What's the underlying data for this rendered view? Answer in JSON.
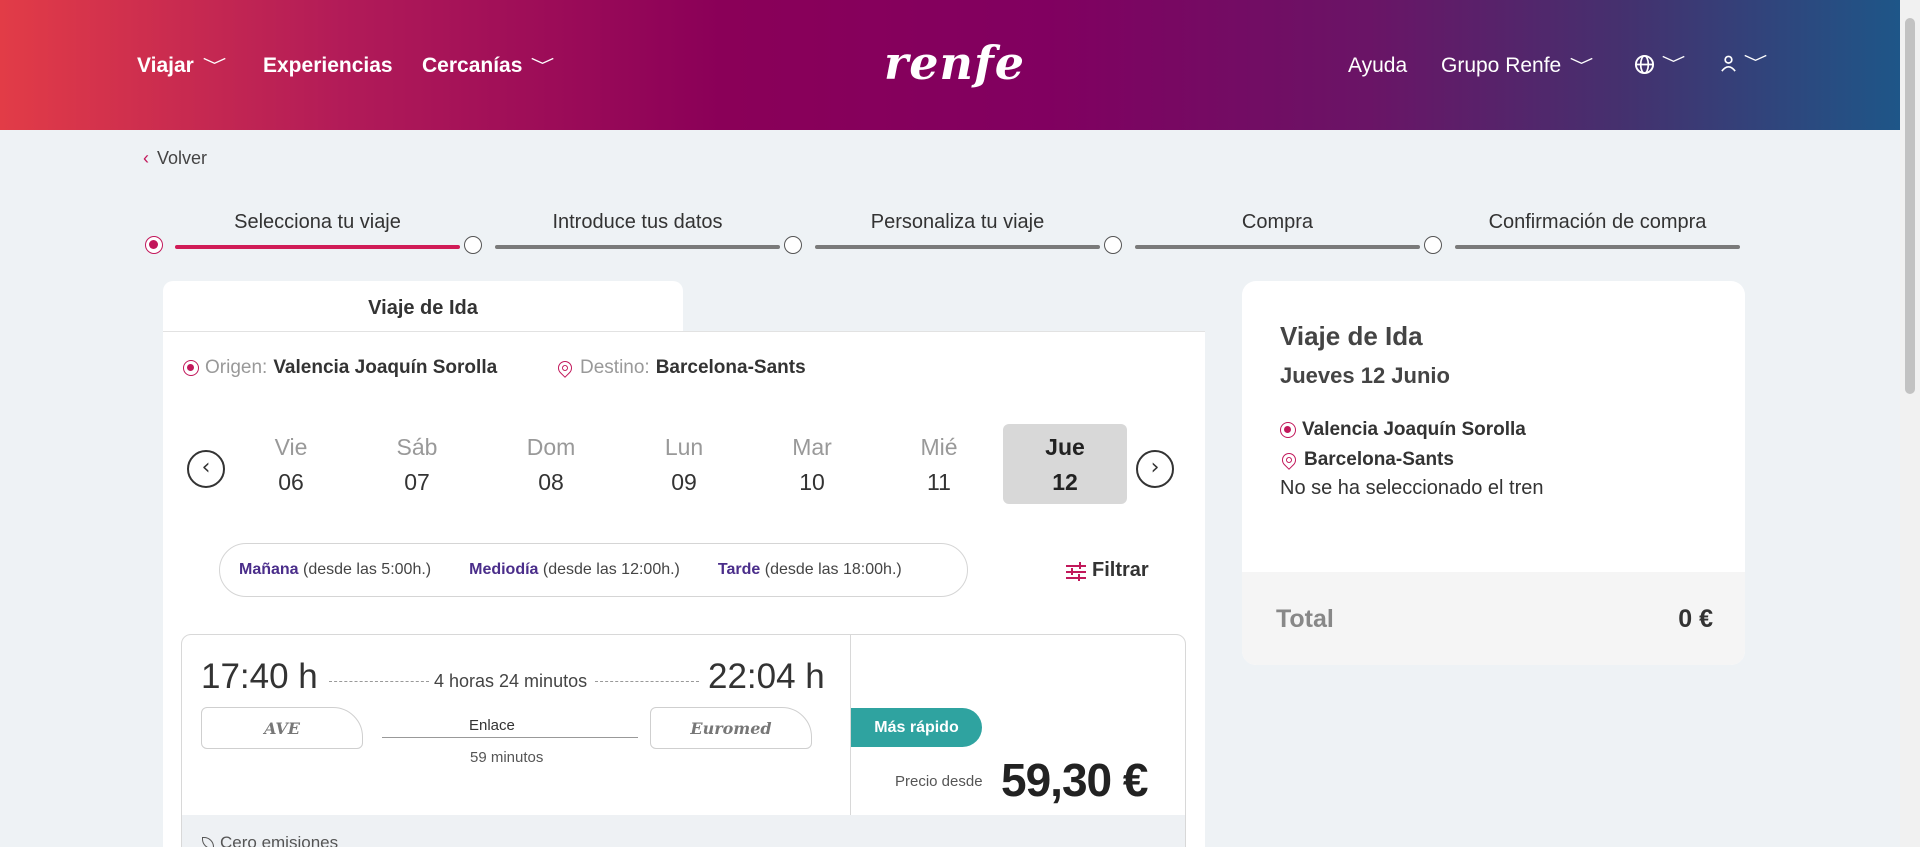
{
  "header": {
    "nav": [
      {
        "label": "Viajar",
        "has_dropdown": true
      },
      {
        "label": "Experiencias",
        "has_dropdown": false
      },
      {
        "label": "Cercanías",
        "has_dropdown": true
      }
    ],
    "logo_text": "renfe",
    "right": [
      {
        "label": "Ayuda",
        "has_dropdown": false
      },
      {
        "label": "Grupo Renfe",
        "has_dropdown": true
      }
    ],
    "icons": [
      "globe-icon",
      "user-icon"
    ],
    "chevron": "﹀"
  },
  "back_label": "Volver",
  "stepper": [
    {
      "label": "Selecciona tu viaje",
      "active": true
    },
    {
      "label": "Introduce tus datos",
      "active": false
    },
    {
      "label": "Personaliza tu viaje",
      "active": false
    },
    {
      "label": "Compra",
      "active": false
    },
    {
      "label": "Confirmación de compra",
      "active": false
    }
  ],
  "trip": {
    "tab_label": "Viaje de Ida",
    "origin_label": "Origen:",
    "origin": "Valencia Joaquín Sorolla",
    "destination_label": "Destino:",
    "destination": "Barcelona-Sants"
  },
  "days": [
    {
      "name": "Vie",
      "num": "06",
      "selected": false
    },
    {
      "name": "Sáb",
      "num": "07",
      "selected": false
    },
    {
      "name": "Dom",
      "num": "08",
      "selected": false
    },
    {
      "name": "Lun",
      "num": "09",
      "selected": false
    },
    {
      "name": "Mar",
      "num": "10",
      "selected": false
    },
    {
      "name": "Mié",
      "num": "11",
      "selected": false
    },
    {
      "name": "Jue",
      "num": "12",
      "selected": true
    }
  ],
  "time_filters": [
    {
      "label": "Mañana",
      "detail": "(desde las 5:00h.)"
    },
    {
      "label": "Mediodía",
      "detail": "(desde las 12:00h.)"
    },
    {
      "label": "Tarde",
      "detail": "(desde las 18:00h.)"
    }
  ],
  "filter_label": "Filtrar",
  "train": {
    "departure": "17:40 h",
    "arrival": "22:04 h",
    "duration": "4 horas 24 minutos",
    "brand_1": "AVE",
    "brand_2": "Euromed",
    "connection_label": "Enlace",
    "connection_time": "59 minutos",
    "badge": "Más rápido",
    "price_from_label": "Precio desde",
    "price": "59,30 €",
    "emissions": "Cero emisiones"
  },
  "summary": {
    "title": "Viaje de Ida",
    "date": "Jueves 12 Junio",
    "origin": "Valencia Joaquín Sorolla",
    "destination": "Barcelona-Sants",
    "no_train": "No se ha seleccionado el tren",
    "total_label": "Total",
    "total_value": "0 €"
  },
  "colors": {
    "accent": "#c2185b",
    "badge": "#2fa3a0",
    "filter_text": "#4a2d8a"
  }
}
